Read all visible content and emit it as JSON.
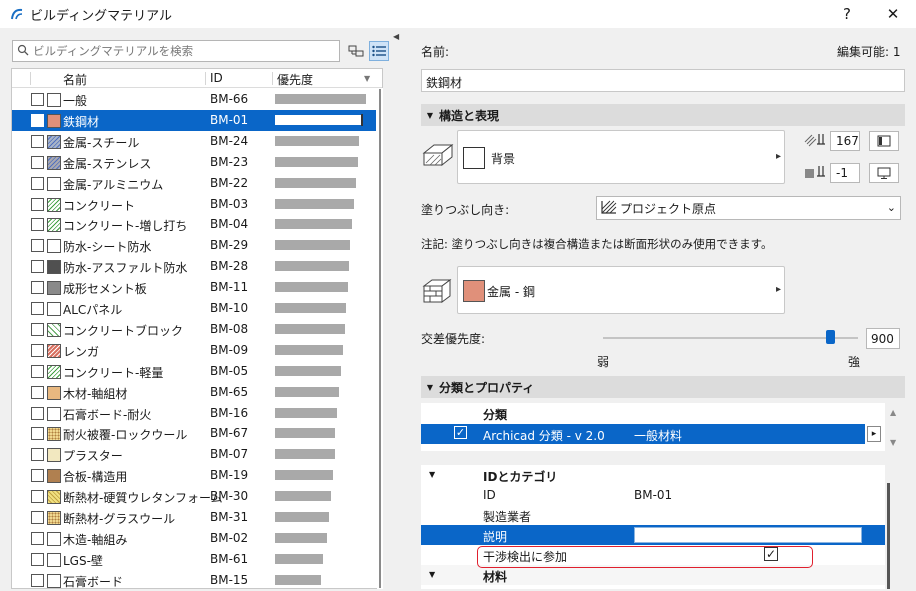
{
  "window": {
    "title": "ビルディングマテリアル",
    "help_label": "?",
    "close_label": "✕"
  },
  "left_panel": {
    "search_placeholder": "ビルディングマテリアルを検索",
    "columns": {
      "name": "名前",
      "id": "ID",
      "priority": "優先度"
    },
    "materials": [
      {
        "name": "一般",
        "id": "BM-66",
        "swatch": "#ffffff",
        "hatch": "none",
        "priority": 0.95
      },
      {
        "name": "鉄鋼材",
        "id": "BM-01",
        "swatch": "#e0907a",
        "hatch": "none",
        "priority": 0.9,
        "selected": true
      },
      {
        "name": "金属-スチール",
        "id": "BM-24",
        "swatch": "#a8b4c8",
        "hatch": "diag-blue",
        "priority": 0.88
      },
      {
        "name": "金属-ステンレス",
        "id": "BM-23",
        "swatch": "#a8a8b0",
        "hatch": "diag-blue",
        "priority": 0.86
      },
      {
        "name": "金属-アルミニウム",
        "id": "BM-22",
        "swatch": "#ffffff",
        "hatch": "none",
        "priority": 0.84
      },
      {
        "name": "コンクリート",
        "id": "BM-03",
        "swatch": "#c8c8c8",
        "hatch": "diag-green",
        "priority": 0.82
      },
      {
        "name": "コンクリート-増し打ち",
        "id": "BM-04",
        "swatch": "#c8c8c8",
        "hatch": "diag-green",
        "priority": 0.8
      },
      {
        "name": "防水-シート防水",
        "id": "BM-29",
        "swatch": "#ffffff",
        "hatch": "none",
        "priority": 0.78
      },
      {
        "name": "防水-アスファルト防水",
        "id": "BM-28",
        "swatch": "#505050",
        "hatch": "none",
        "priority": 0.77
      },
      {
        "name": "成形セメント板",
        "id": "BM-11",
        "swatch": "#8a8a8a",
        "hatch": "none",
        "priority": 0.76
      },
      {
        "name": "ALCパネル",
        "id": "BM-10",
        "swatch": "#ffffff",
        "hatch": "none",
        "priority": 0.74
      },
      {
        "name": "コンクリートブロック",
        "id": "BM-08",
        "swatch": "#d0d0d0",
        "hatch": "cross-green",
        "priority": 0.73
      },
      {
        "name": "レンガ",
        "id": "BM-09",
        "swatch": "#d87060",
        "hatch": "diag-red",
        "priority": 0.71
      },
      {
        "name": "コンクリート-軽量",
        "id": "BM-05",
        "swatch": "#c8c8c8",
        "hatch": "diag-green",
        "priority": 0.69
      },
      {
        "name": "木材-軸組材",
        "id": "BM-65",
        "swatch": "#e8b880",
        "hatch": "none",
        "priority": 0.67
      },
      {
        "name": "石膏ボード-耐火",
        "id": "BM-16",
        "swatch": "#ffffff",
        "hatch": "none",
        "priority": 0.65
      },
      {
        "name": "耐火被覆-ロックウール",
        "id": "BM-67",
        "swatch": "#f0d890",
        "hatch": "dots",
        "priority": 0.63
      },
      {
        "name": "プラスター",
        "id": "BM-07",
        "swatch": "#f2e8c0",
        "hatch": "none",
        "priority": 0.62
      },
      {
        "name": "合板-構造用",
        "id": "BM-19",
        "swatch": "#b08050",
        "hatch": "none",
        "priority": 0.6
      },
      {
        "name": "断熱材-硬質ウレタンフォーム",
        "id": "BM-30",
        "swatch": "#f0e080",
        "hatch": "wave",
        "priority": 0.58
      },
      {
        "name": "断熱材-グラスウール",
        "id": "BM-31",
        "swatch": "#f0d890",
        "hatch": "dots",
        "priority": 0.56
      },
      {
        "name": "木造-軸組み",
        "id": "BM-02",
        "swatch": "#ffffff",
        "hatch": "none",
        "priority": 0.54
      },
      {
        "name": "LGS-壁",
        "id": "BM-61",
        "swatch": "#ffffff",
        "hatch": "none",
        "priority": 0.5
      },
      {
        "name": "石膏ボード",
        "id": "BM-15",
        "swatch": "#ffffff",
        "hatch": "none",
        "priority": 0.48
      }
    ]
  },
  "right_panel": {
    "name_label": "名前:",
    "editable_label": "編集可能: 1",
    "name_value": "鉄鋼材",
    "structure_section": "構造と表現",
    "background_label": "背景",
    "pen_value_1": "167",
    "pen_value_2": "-1",
    "fill_orientation_label": "塗りつぶし向き:",
    "fill_orientation_value": "プロジェクト原点",
    "note_text": "注記: 塗りつぶし向きは複合構造または断面形状のみ使用できます。",
    "surface_label": "金属 - 鋼",
    "surface_color": "#e0907a",
    "intersection_label": "交差優先度:",
    "intersection_value": "900",
    "intersection_level": 0.89,
    "weak_label": "弱",
    "strong_label": "強",
    "classification_section": "分類とプロパティ",
    "classification_header": "分類",
    "classification_system": "Archicad 分類 - v 2.0",
    "classification_value": "一般材料",
    "id_category_header": "IDとカテゴリ",
    "props": [
      {
        "label": "ID",
        "value": "BM-01"
      },
      {
        "label": "製造業者",
        "value": ""
      },
      {
        "label": "説明",
        "value": ""
      }
    ],
    "collision_label": "干渉検出に参加",
    "collision_checked": true,
    "material_header": "材料"
  },
  "colors": {
    "accent": "#0a66c8",
    "highlight": "#e0202e"
  }
}
